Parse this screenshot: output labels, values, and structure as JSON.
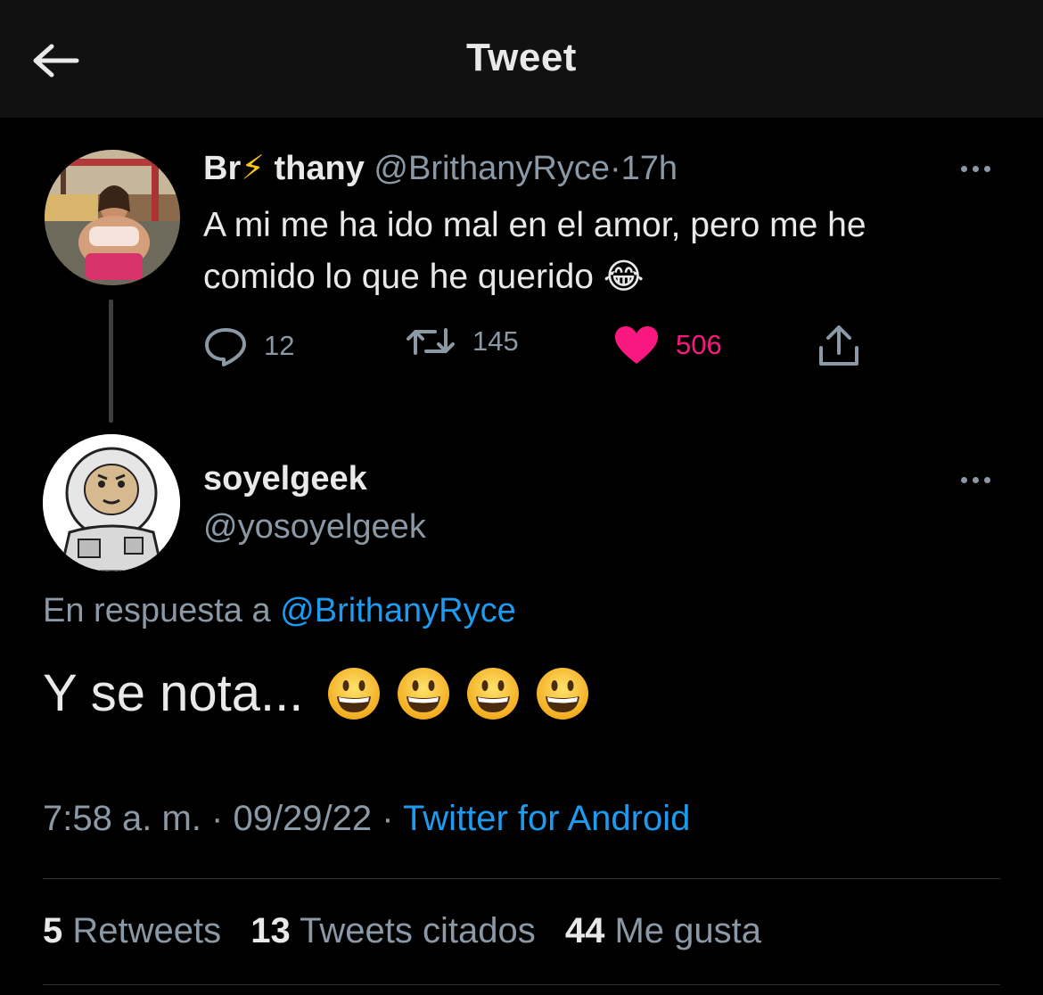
{
  "header": {
    "title": "Tweet",
    "back_icon": "arrow-left-icon"
  },
  "parent_tweet": {
    "display_name_prefix": "Br",
    "display_name_emoji": "⚡",
    "display_name_suffix": "thany",
    "handle": "@BrithanyRyce",
    "separator": "·",
    "time": "17h",
    "text": "A mi me ha ido mal en el amor, pero me he comido lo que he querido",
    "text_emoji": "😂",
    "actions": {
      "replies": "12",
      "retweets": "145",
      "likes": "506"
    }
  },
  "reply_tweet": {
    "display_name": "soyelgeek",
    "handle": "@yosoyelgeek",
    "reply_to_label": "En respuesta a",
    "reply_to_handle": "@BrithanyRyce",
    "text": "Y se nota...",
    "emoji_count": 4,
    "timestamp": "7:58 a. m.",
    "date": "09/29/22",
    "source": "Twitter for Android",
    "separator": "·",
    "stats": {
      "retweets_count": "5",
      "retweets_label": "Retweets",
      "quotes_count": "13",
      "quotes_label": "Tweets citados",
      "likes_count": "44",
      "likes_label": "Me gusta"
    }
  },
  "colors": {
    "background": "#000000",
    "header_bg": "#111111",
    "text_primary": "#e7e9ea",
    "text_secondary": "#8b98a5",
    "link": "#1d9bf0",
    "like": "#f91880"
  }
}
